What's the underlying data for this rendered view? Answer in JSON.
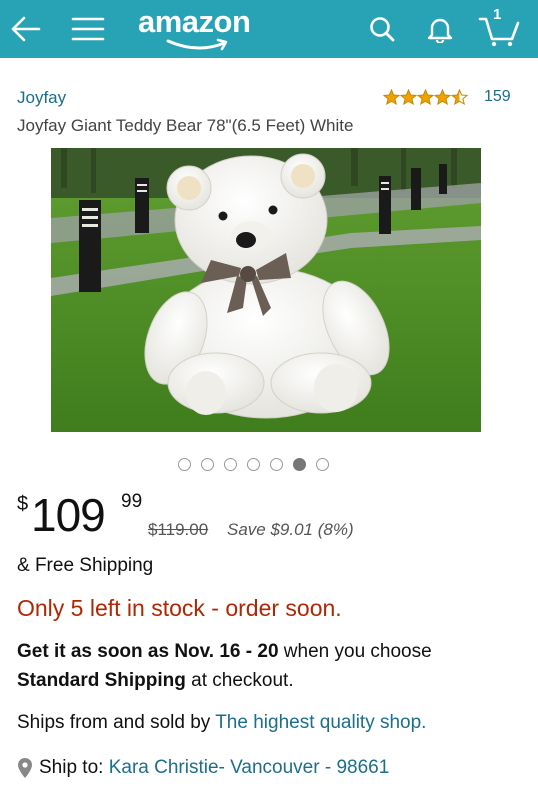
{
  "header": {
    "logo_text": "amazon",
    "cart_count": "1",
    "background_color": "#28a3b5"
  },
  "product": {
    "brand": "Joyfay",
    "rating_stars": 4.5,
    "review_count": "159",
    "title": "Joyfay Giant Teddy Bear 78\"(6.5 Feet) White"
  },
  "carousel": {
    "total_images": 7,
    "active_index": 5
  },
  "pricing": {
    "currency_symbol": "$",
    "price_whole": "109",
    "price_fraction": "99",
    "list_price": "$119.00",
    "savings": "Save $9.01 (8%)"
  },
  "shipping": {
    "free_shipping": "& Free Shipping",
    "stock_status": "Only 5 left in stock - order soon."
  },
  "delivery": {
    "get_it_prefix": "Get it as soon as Nov. 16 - 20",
    "when_you_choose": " when you choose",
    "method": "Standard Shipping",
    "at_checkout": " at checkout."
  },
  "seller": {
    "prefix": "Ships from and sold by ",
    "name": "The highest quality shop."
  },
  "ship_to": {
    "label": "Ship to: ",
    "address": "Kara Christie- Vancouver - 98661"
  },
  "colors": {
    "link": "#1b6f8c",
    "stock_warning": "#b12704",
    "star": "#f0a300"
  }
}
